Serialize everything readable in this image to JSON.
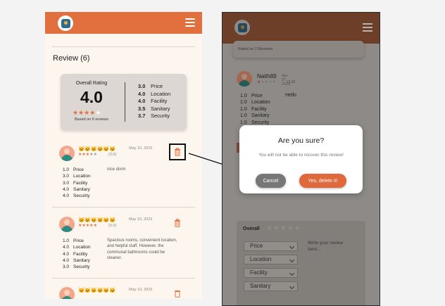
{
  "left": {
    "review_heading": "Review (6)",
    "summary": {
      "overall_label": "Overall Rating",
      "overall_value": "4.0",
      "overall_stars": 4,
      "based_on": "Based on 6 reviews",
      "categories": [
        {
          "value": "3.0",
          "label": "Price"
        },
        {
          "value": "4.0",
          "label": "Location"
        },
        {
          "value": "4.0",
          "label": "Facility"
        },
        {
          "value": "3.5",
          "label": "Sanitary"
        },
        {
          "value": "3.7",
          "label": "Security"
        }
      ]
    },
    "reviews": [
      {
        "cat_icons": "🐱🐱🐱🐱🐱🐱",
        "date": "May 10, 2023",
        "stars": 3,
        "count": "(3.0)",
        "comment": "nice dorm",
        "categories": [
          {
            "value": "1.0",
            "label": "Price"
          },
          {
            "value": "3.0",
            "label": "Location"
          },
          {
            "value": "3.0",
            "label": "Facility"
          },
          {
            "value": "4.0",
            "label": "Sanitary"
          },
          {
            "value": "4.0",
            "label": "Security"
          }
        ]
      },
      {
        "cat_icons": "🐱🐱🐱🐱🐱🐱",
        "date": "May 10, 2023",
        "stars": 5,
        "count": "(5.0)",
        "comment": "Spacious rooms, convenient location, and helpful staff. However, the communal bathrooms could be cleaner.",
        "categories": [
          {
            "value": "1.0",
            "label": "Price"
          },
          {
            "value": "4.0",
            "label": "Location"
          },
          {
            "value": "4.0",
            "label": "Facility"
          },
          {
            "value": "4.0",
            "label": "Sanitary"
          },
          {
            "value": "3.0",
            "label": "Security"
          }
        ]
      },
      {
        "cat_icons": "🐱🐱🐱🐱🐱🐱",
        "date": "May 10, 2023"
      }
    ]
  },
  "right": {
    "ghost_card_text": "Rated on 2 Reviews",
    "review": {
      "name": "Naith89",
      "date": "Apr 27, 2023",
      "count": "(1.0)",
      "comment": "Hello",
      "categories": [
        {
          "value": "1.0",
          "label": "Price"
        },
        {
          "value": "1.0",
          "label": "Location"
        },
        {
          "value": "1.0",
          "label": "Facility"
        },
        {
          "value": "1.0",
          "label": "Sanitary"
        },
        {
          "value": "1.0",
          "label": "Security"
        }
      ]
    },
    "form": {
      "overall_label": "Overall",
      "selects": [
        "Price",
        "Location",
        "Facility",
        "Sanitary"
      ],
      "textarea_placeholder": "Write your review here..."
    }
  },
  "modal": {
    "title": "Are you sure?",
    "message": "You will not be able to recover this review!",
    "cancel_label": "Cancel",
    "confirm_label": "Yes, delete it!"
  },
  "colors": {
    "brand": "#e2703f",
    "star": "#e2703f",
    "background": "#fdf6ee"
  }
}
